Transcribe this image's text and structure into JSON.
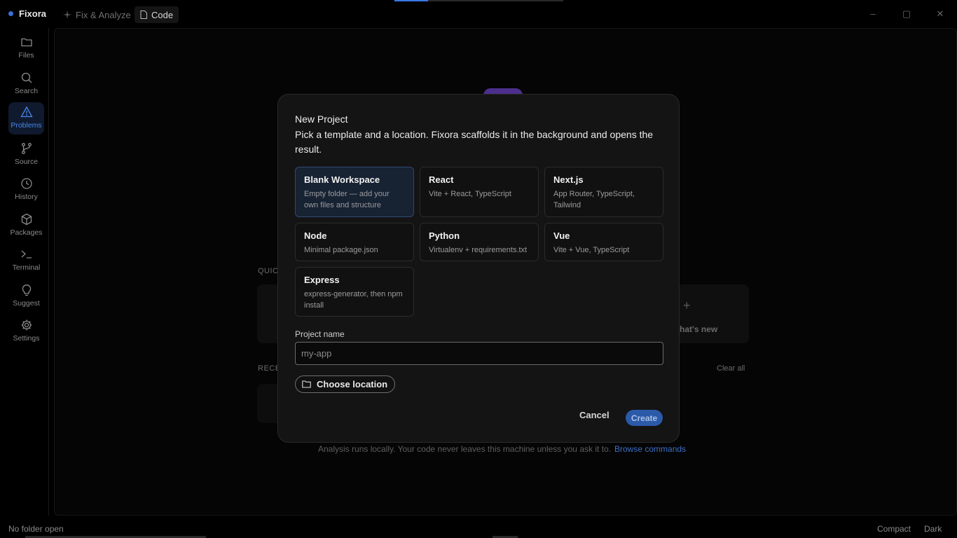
{
  "app": {
    "name": "Fixora"
  },
  "titlebar": {
    "tabs": [
      {
        "label": "Fix & Analyze"
      },
      {
        "label": "Code"
      }
    ],
    "controls": {
      "minimize": "–",
      "maximize": "▢",
      "close": "✕"
    }
  },
  "sidebar": {
    "items": [
      {
        "label": "Files",
        "icon": "folder-icon"
      },
      {
        "label": "Search",
        "icon": "search-icon"
      },
      {
        "label": "Problems",
        "icon": "warning-icon",
        "active": true
      },
      {
        "label": "Source",
        "icon": "git-branch-icon"
      },
      {
        "label": "History",
        "icon": "clock-icon"
      },
      {
        "label": "Packages",
        "icon": "package-icon"
      },
      {
        "label": "Terminal",
        "icon": "terminal-icon"
      },
      {
        "label": "Suggest",
        "icon": "lightbulb-icon"
      },
      {
        "label": "Settings",
        "icon": "gear-icon"
      }
    ]
  },
  "background": {
    "quick_label": "QUICK",
    "whats_new": "hat's new",
    "recent_label": "RECE",
    "clear_all": "Clear all",
    "footer_text": "Analysis runs locally. Your code never leaves this machine unless you ask it to.",
    "footer_link": "Browse commands"
  },
  "modal": {
    "title": "New Project",
    "description": "Pick a template and a location. Fixora scaffolds it in the background and opens the result.",
    "templates": [
      {
        "name": "Blank Workspace",
        "desc": "Empty folder — add your own files and structure",
        "selected": true
      },
      {
        "name": "React",
        "desc": "Vite + React, TypeScript"
      },
      {
        "name": "Next.js",
        "desc": "App Router, TypeScript, Tailwind"
      },
      {
        "name": "Node",
        "desc": "Minimal package.json"
      },
      {
        "name": "Python",
        "desc": "Virtualenv + requirements.txt"
      },
      {
        "name": "Vue",
        "desc": "Vite + Vue, TypeScript"
      },
      {
        "name": "Express",
        "desc": "express-generator, then npm install"
      }
    ],
    "project_name_label": "Project name",
    "project_name_value": "",
    "project_name_placeholder": "my-app",
    "choose_location": "Choose location",
    "cancel": "Cancel",
    "create": "Create"
  },
  "statusbar": {
    "left": "No folder open",
    "compact": "Compact",
    "theme": "Dark"
  },
  "colors": {
    "accent": "#4a86e8",
    "create_button": "#2b5aa8",
    "selected_template": "#172233"
  }
}
